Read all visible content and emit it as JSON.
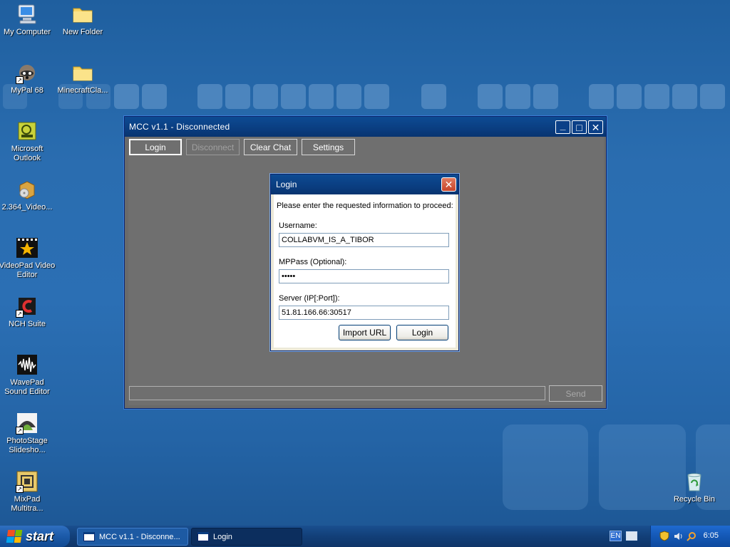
{
  "desktop": {
    "icons": [
      {
        "label": "My Computer",
        "icon": "computer-icon"
      },
      {
        "label": "New Folder",
        "icon": "folder-icon"
      },
      {
        "label": "MyPal 68",
        "icon": "raccoon-icon"
      },
      {
        "label": "MinecraftCla...",
        "icon": "folder-icon"
      },
      {
        "label": "Microsoft Outlook",
        "icon": "outlook-icon"
      },
      {
        "label": "2.364_Video...",
        "icon": "installer-box-icon"
      },
      {
        "label": "VideoPad Video Editor",
        "icon": "videopad-icon"
      },
      {
        "label": "NCH Suite",
        "icon": "nch-icon"
      },
      {
        "label": "WavePad Sound Editor",
        "icon": "wavepad-icon"
      },
      {
        "label": "PhotoStage Slidesho...",
        "icon": "photostage-icon"
      },
      {
        "label": "MixPad Multitra...",
        "icon": "mixpad-icon"
      },
      {
        "label": "Recycle Bin",
        "icon": "recycle-bin-icon"
      }
    ]
  },
  "main_window": {
    "title": "MCC v1.1 - Disconnected",
    "controls": {
      "minimize": "_",
      "maximize": "□",
      "close": "✕"
    },
    "toolbar": {
      "login": "Login",
      "disconnect": "Disconnect",
      "clear_chat": "Clear Chat",
      "settings": "Settings"
    },
    "chat_input_value": "",
    "send": "Send"
  },
  "login_dialog": {
    "title": "Login",
    "close": "✕",
    "prompt": "Please enter the requested information to proceed:",
    "username_label": "Username:",
    "username_value": "COLLABVM_IS_A_TIBOR",
    "mppass_label": "MPPass (Optional):",
    "mppass_value": "•••••",
    "server_label": "Server (IP[:Port]):",
    "server_value": "51.81.166.66:30517",
    "import_url": "Import URL",
    "login": "Login"
  },
  "taskbar": {
    "start": "start",
    "tasks": [
      {
        "label": "MCC v1.1 - Disconne..."
      },
      {
        "label": "Login"
      }
    ],
    "language": "EN",
    "clock": "6:05"
  },
  "colors": {
    "desktop_top": "#1f5f9f",
    "titlebar": "#0a3d80",
    "window_body": "#6f6f6f",
    "dialog_bg": "#ffffff",
    "close_red": "#c8442a"
  }
}
